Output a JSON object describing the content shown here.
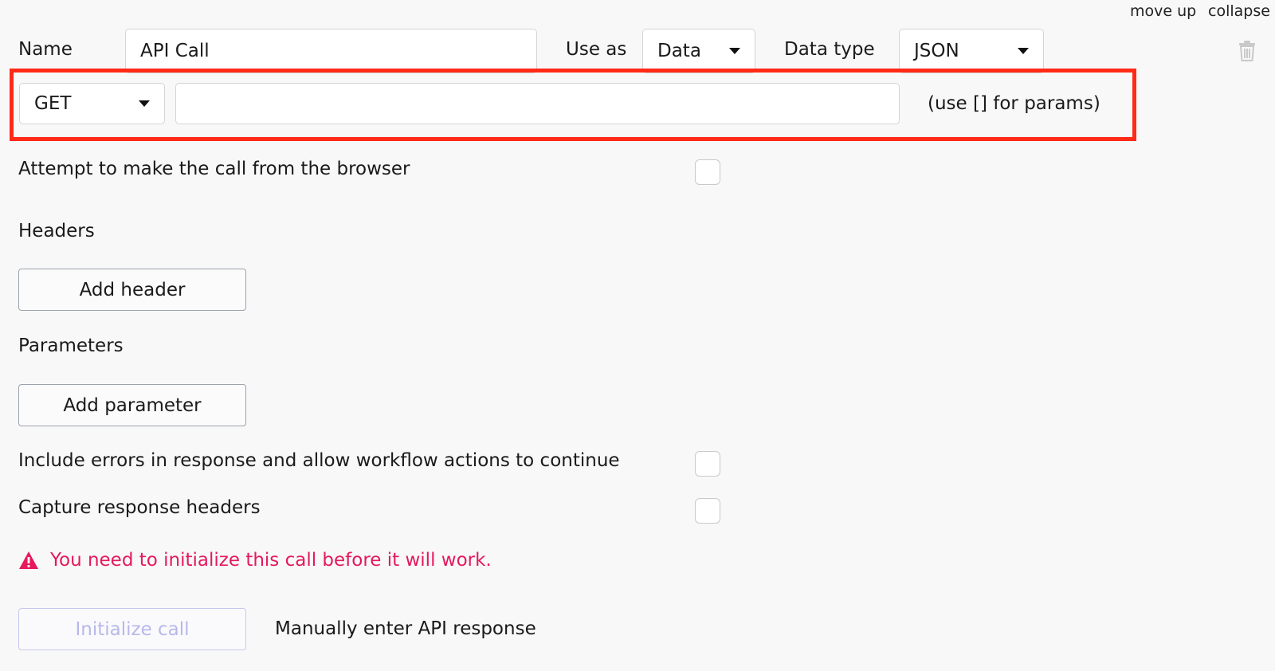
{
  "top_actions": {
    "move_up": "move up",
    "collapse": "collapse"
  },
  "icons": {
    "delete": "trash-icon",
    "warning": "warning-triangle-icon",
    "dropdown": "caret-down-icon"
  },
  "colors": {
    "highlight": "#ff2a17",
    "error": "#e5195b",
    "disabled_text": "#b7b8ea"
  },
  "call": {
    "name_label": "Name",
    "name_value": "API Call",
    "use_as_label": "Use as",
    "use_as_value": "Data",
    "data_type_label": "Data type",
    "data_type_value": "JSON",
    "method_value": "GET",
    "url_value": "",
    "url_hint": "(use [] for params)"
  },
  "options": {
    "browser_call_label": "Attempt to make the call from the browser",
    "include_errors_label": "Include errors in response and allow workflow actions to continue",
    "capture_headers_label": "Capture response headers"
  },
  "headers": {
    "title": "Headers",
    "add_button": "Add header"
  },
  "parameters": {
    "title": "Parameters",
    "add_button": "Add parameter"
  },
  "warning_message": "You need to initialize this call before it will work.",
  "footer": {
    "initialize_button": "Initialize call",
    "manual_link": "Manually enter API response"
  }
}
